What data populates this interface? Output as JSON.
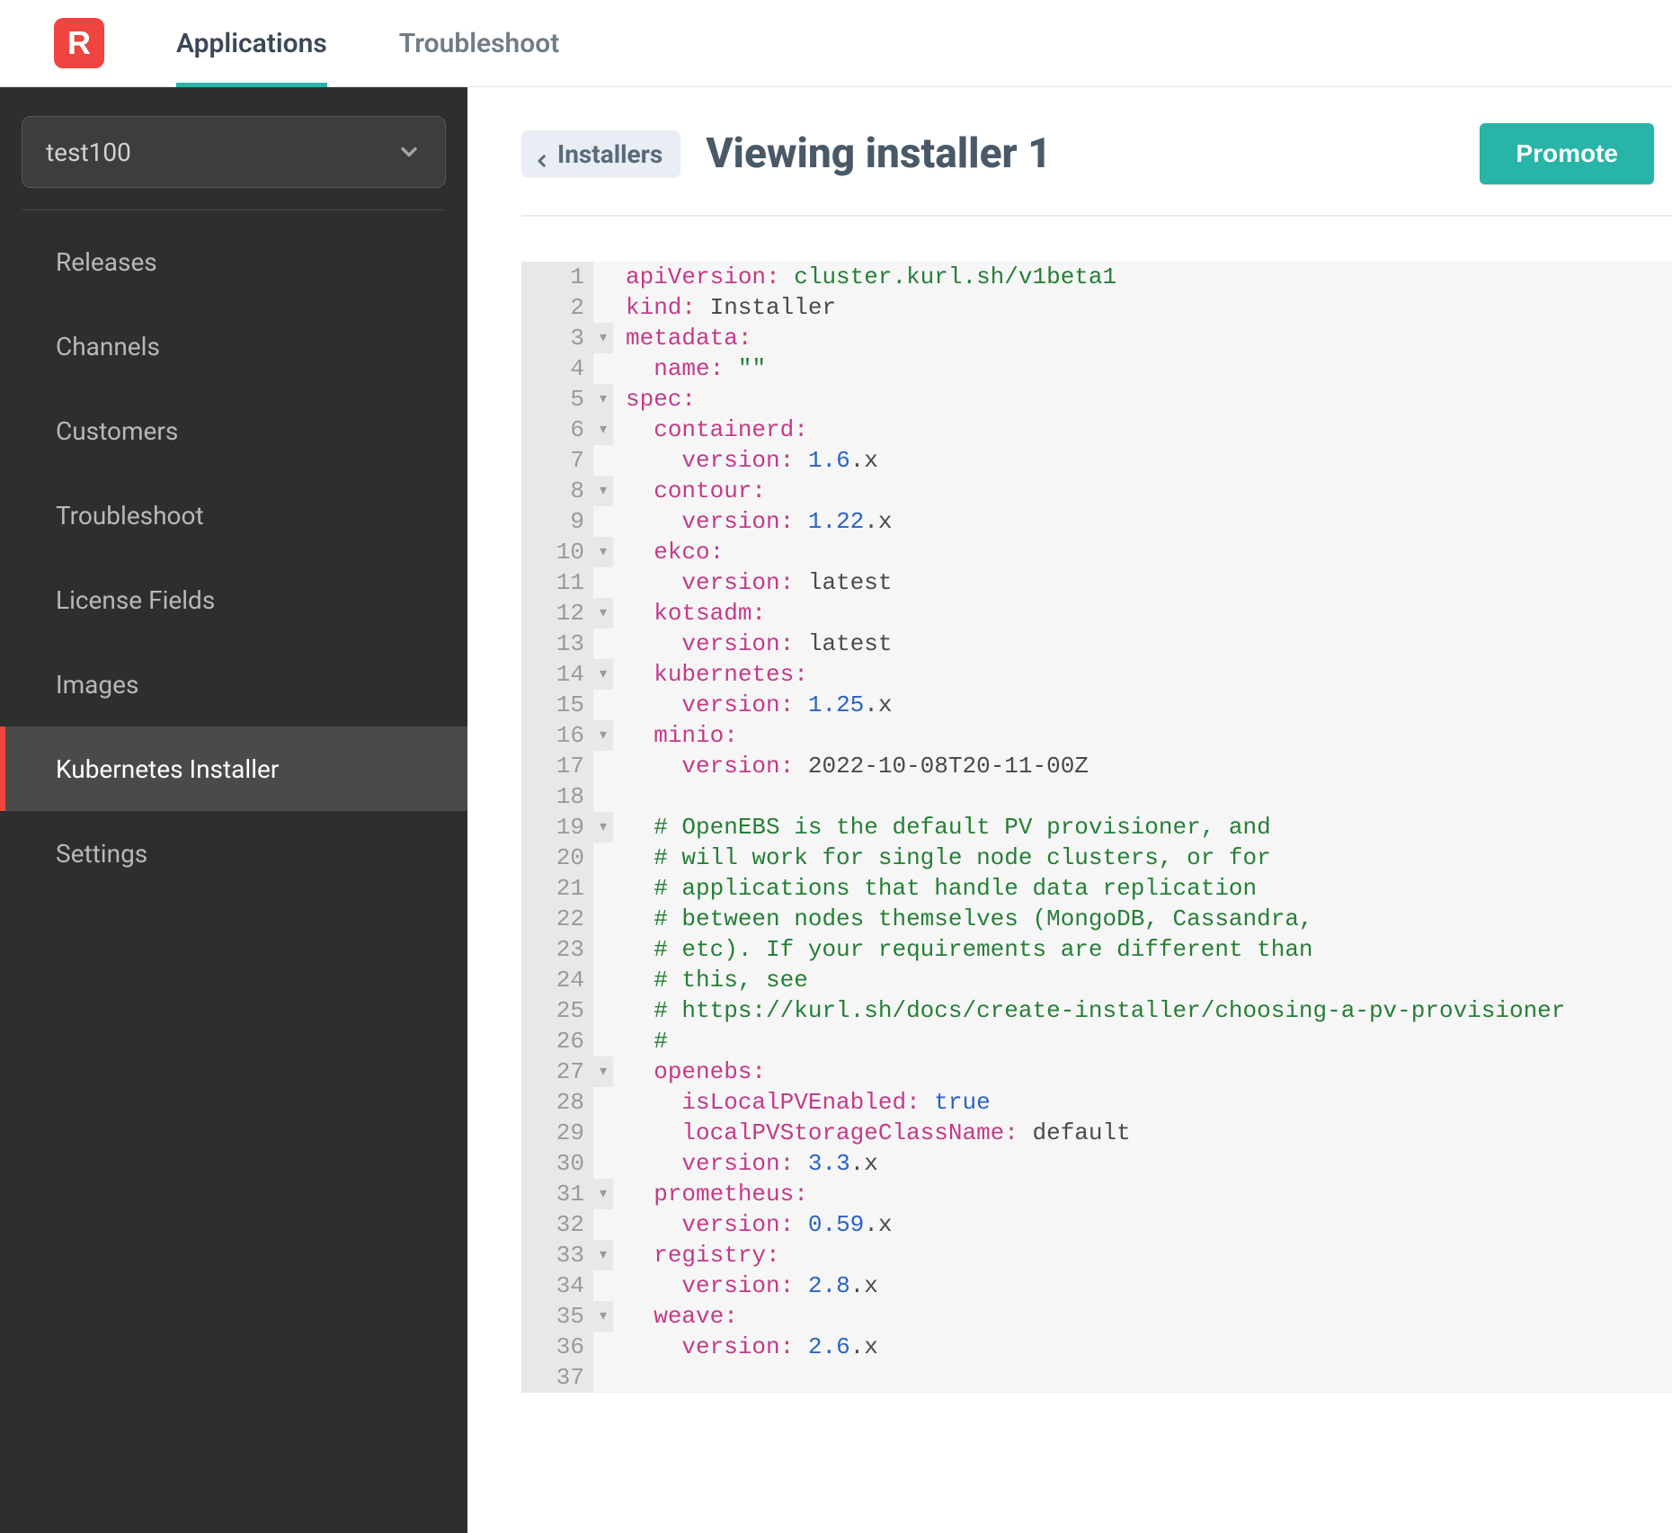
{
  "logo_letter": "R",
  "topnav": [
    {
      "label": "Applications",
      "active": true
    },
    {
      "label": "Troubleshoot",
      "active": false
    }
  ],
  "app_selector_value": "test100",
  "sidebar": {
    "items": [
      {
        "label": "Releases",
        "active": false
      },
      {
        "label": "Channels",
        "active": false
      },
      {
        "label": "Customers",
        "active": false
      },
      {
        "label": "Troubleshoot",
        "active": false
      },
      {
        "label": "License Fields",
        "active": false
      },
      {
        "label": "Images",
        "active": false
      },
      {
        "label": "Kubernetes Installer",
        "active": true
      },
      {
        "label": "Settings",
        "active": false
      }
    ]
  },
  "breadcrumb_back_label": "Installers",
  "page_title": "Viewing installer 1",
  "promote_label": "Promote",
  "editor": {
    "lines": [
      {
        "n": 1,
        "fold": "",
        "tokens": [
          [
            "key",
            "apiVersion:"
          ],
          [
            "plain",
            " "
          ],
          [
            "val",
            "cluster.kurl.sh/v1beta1"
          ]
        ]
      },
      {
        "n": 2,
        "fold": "",
        "tokens": [
          [
            "key",
            "kind:"
          ],
          [
            "plain",
            " "
          ],
          [
            "plain",
            "Installer"
          ]
        ]
      },
      {
        "n": 3,
        "fold": "▾",
        "tokens": [
          [
            "key",
            "metadata:"
          ]
        ]
      },
      {
        "n": 4,
        "fold": "",
        "tokens": [
          [
            "plain",
            "  "
          ],
          [
            "key",
            "name:"
          ],
          [
            "plain",
            " "
          ],
          [
            "val",
            "\"\""
          ]
        ]
      },
      {
        "n": 5,
        "fold": "▾",
        "tokens": [
          [
            "key",
            "spec:"
          ]
        ]
      },
      {
        "n": 6,
        "fold": "▾",
        "tokens": [
          [
            "plain",
            "  "
          ],
          [
            "key",
            "containerd:"
          ]
        ]
      },
      {
        "n": 7,
        "fold": "",
        "tokens": [
          [
            "plain",
            "    "
          ],
          [
            "key",
            "version:"
          ],
          [
            "plain",
            " "
          ],
          [
            "num",
            "1.6"
          ],
          [
            "plain",
            ".x"
          ]
        ]
      },
      {
        "n": 8,
        "fold": "▾",
        "tokens": [
          [
            "plain",
            "  "
          ],
          [
            "key",
            "contour:"
          ]
        ]
      },
      {
        "n": 9,
        "fold": "",
        "tokens": [
          [
            "plain",
            "    "
          ],
          [
            "key",
            "version:"
          ],
          [
            "plain",
            " "
          ],
          [
            "num",
            "1.22"
          ],
          [
            "plain",
            ".x"
          ]
        ]
      },
      {
        "n": 10,
        "fold": "▾",
        "tokens": [
          [
            "plain",
            "  "
          ],
          [
            "key",
            "ekco:"
          ]
        ]
      },
      {
        "n": 11,
        "fold": "",
        "tokens": [
          [
            "plain",
            "    "
          ],
          [
            "key",
            "version:"
          ],
          [
            "plain",
            " "
          ],
          [
            "plain",
            "latest"
          ]
        ]
      },
      {
        "n": 12,
        "fold": "▾",
        "tokens": [
          [
            "plain",
            "  "
          ],
          [
            "key",
            "kotsadm:"
          ]
        ]
      },
      {
        "n": 13,
        "fold": "",
        "tokens": [
          [
            "plain",
            "    "
          ],
          [
            "key",
            "version:"
          ],
          [
            "plain",
            " "
          ],
          [
            "plain",
            "latest"
          ]
        ]
      },
      {
        "n": 14,
        "fold": "▾",
        "tokens": [
          [
            "plain",
            "  "
          ],
          [
            "key",
            "kubernetes:"
          ]
        ]
      },
      {
        "n": 15,
        "fold": "",
        "tokens": [
          [
            "plain",
            "    "
          ],
          [
            "key",
            "version:"
          ],
          [
            "plain",
            " "
          ],
          [
            "num",
            "1.25"
          ],
          [
            "plain",
            ".x"
          ]
        ]
      },
      {
        "n": 16,
        "fold": "▾",
        "tokens": [
          [
            "plain",
            "  "
          ],
          [
            "key",
            "minio:"
          ]
        ]
      },
      {
        "n": 17,
        "fold": "",
        "tokens": [
          [
            "plain",
            "    "
          ],
          [
            "key",
            "version:"
          ],
          [
            "plain",
            " "
          ],
          [
            "plain",
            "2022-10-08T20-11-00Z"
          ]
        ]
      },
      {
        "n": 18,
        "fold": "",
        "tokens": []
      },
      {
        "n": 19,
        "fold": "▾",
        "tokens": [
          [
            "plain",
            "  "
          ],
          [
            "comment",
            "# OpenEBS is the default PV provisioner, and"
          ]
        ]
      },
      {
        "n": 20,
        "fold": "",
        "tokens": [
          [
            "plain",
            "  "
          ],
          [
            "comment",
            "# will work for single node clusters, or for"
          ]
        ]
      },
      {
        "n": 21,
        "fold": "",
        "tokens": [
          [
            "plain",
            "  "
          ],
          [
            "comment",
            "# applications that handle data replication"
          ]
        ]
      },
      {
        "n": 22,
        "fold": "",
        "tokens": [
          [
            "plain",
            "  "
          ],
          [
            "comment",
            "# between nodes themselves (MongoDB, Cassandra,"
          ]
        ]
      },
      {
        "n": 23,
        "fold": "",
        "tokens": [
          [
            "plain",
            "  "
          ],
          [
            "comment",
            "# etc). If your requirements are different than"
          ]
        ]
      },
      {
        "n": 24,
        "fold": "",
        "tokens": [
          [
            "plain",
            "  "
          ],
          [
            "comment",
            "# this, see"
          ]
        ]
      },
      {
        "n": 25,
        "fold": "",
        "tokens": [
          [
            "plain",
            "  "
          ],
          [
            "comment",
            "# https://kurl.sh/docs/create-installer/choosing-a-pv-provisioner"
          ]
        ]
      },
      {
        "n": 26,
        "fold": "",
        "tokens": [
          [
            "plain",
            "  "
          ],
          [
            "comment",
            "#"
          ]
        ]
      },
      {
        "n": 27,
        "fold": "▾",
        "tokens": [
          [
            "plain",
            "  "
          ],
          [
            "key",
            "openebs:"
          ]
        ]
      },
      {
        "n": 28,
        "fold": "",
        "tokens": [
          [
            "plain",
            "    "
          ],
          [
            "key",
            "isLocalPVEnabled:"
          ],
          [
            "plain",
            " "
          ],
          [
            "const",
            "true"
          ]
        ]
      },
      {
        "n": 29,
        "fold": "",
        "tokens": [
          [
            "plain",
            "    "
          ],
          [
            "key",
            "localPVStorageClassName:"
          ],
          [
            "plain",
            " "
          ],
          [
            "plain",
            "default"
          ]
        ]
      },
      {
        "n": 30,
        "fold": "",
        "tokens": [
          [
            "plain",
            "    "
          ],
          [
            "key",
            "version:"
          ],
          [
            "plain",
            " "
          ],
          [
            "num",
            "3.3"
          ],
          [
            "plain",
            ".x"
          ]
        ]
      },
      {
        "n": 31,
        "fold": "▾",
        "tokens": [
          [
            "plain",
            "  "
          ],
          [
            "key",
            "prometheus:"
          ]
        ]
      },
      {
        "n": 32,
        "fold": "",
        "tokens": [
          [
            "plain",
            "    "
          ],
          [
            "key",
            "version:"
          ],
          [
            "plain",
            " "
          ],
          [
            "num",
            "0.59"
          ],
          [
            "plain",
            ".x"
          ]
        ]
      },
      {
        "n": 33,
        "fold": "▾",
        "tokens": [
          [
            "plain",
            "  "
          ],
          [
            "key",
            "registry:"
          ]
        ]
      },
      {
        "n": 34,
        "fold": "",
        "tokens": [
          [
            "plain",
            "    "
          ],
          [
            "key",
            "version:"
          ],
          [
            "plain",
            " "
          ],
          [
            "num",
            "2.8"
          ],
          [
            "plain",
            ".x"
          ]
        ]
      },
      {
        "n": 35,
        "fold": "▾",
        "tokens": [
          [
            "plain",
            "  "
          ],
          [
            "key",
            "weave:"
          ]
        ]
      },
      {
        "n": 36,
        "fold": "",
        "tokens": [
          [
            "plain",
            "    "
          ],
          [
            "key",
            "version:"
          ],
          [
            "plain",
            " "
          ],
          [
            "num",
            "2.6"
          ],
          [
            "plain",
            ".x"
          ]
        ]
      },
      {
        "n": 37,
        "fold": "",
        "tokens": []
      }
    ]
  }
}
